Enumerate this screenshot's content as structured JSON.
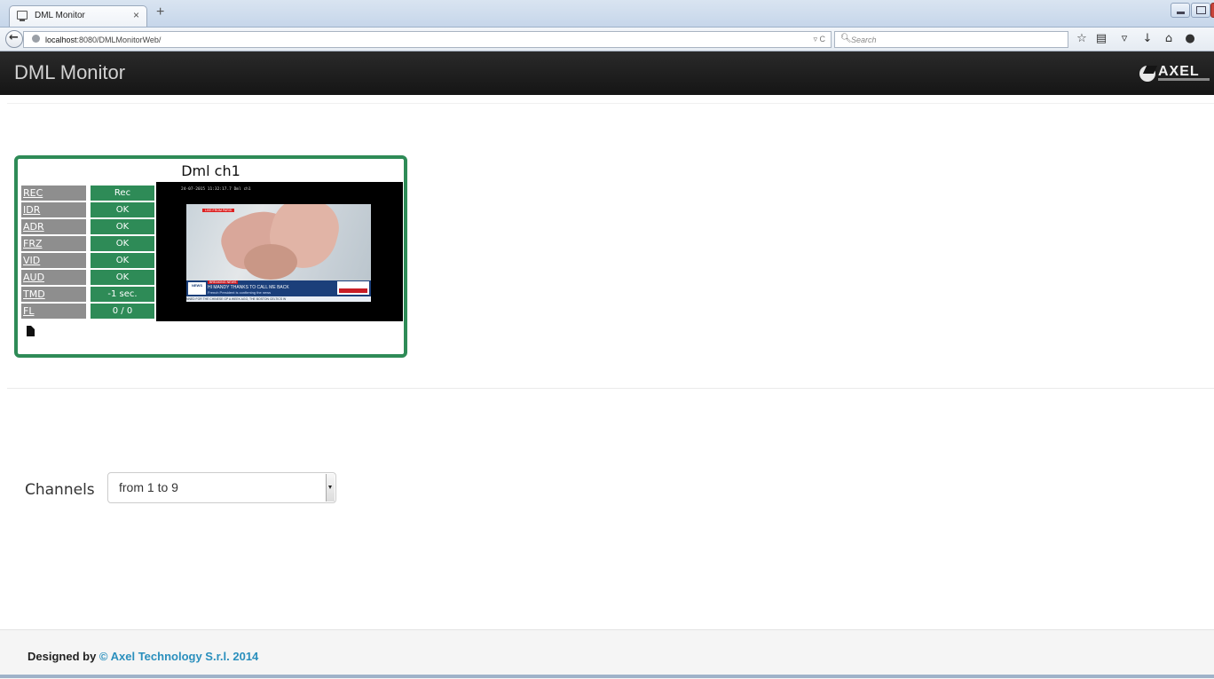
{
  "browser": {
    "tab_title": "DML Monitor",
    "tab_close": "×",
    "new_tab": "+",
    "url_host": "localhost",
    "url_rest": ":8080/DMLMonitorWeb/",
    "url_tools": "▿ C",
    "search_placeholder": "Search",
    "toolbar_icons": [
      "star-icon",
      "bookmarks-icon",
      "pocket-icon",
      "download-icon",
      "home-icon",
      "chat-icon"
    ]
  },
  "app": {
    "title": "DML Monitor",
    "logo_text": "AXEL"
  },
  "channel": {
    "name": "Dml ch1",
    "status": [
      {
        "label": "REC",
        "value": "Rec"
      },
      {
        "label": "IDR",
        "value": "OK"
      },
      {
        "label": "ADR",
        "value": "OK"
      },
      {
        "label": "FRZ",
        "value": "OK"
      },
      {
        "label": "VID",
        "value": "OK"
      },
      {
        "label": "AUD",
        "value": "OK"
      },
      {
        "label": "TMD",
        "value": "-1 sec."
      },
      {
        "label": "FL",
        "value": "0 / 0"
      }
    ],
    "preview": {
      "timestamp": "24-07-2015  11:32:17.7   Dml ch1",
      "live_tag": "LIVE FROM PARIS",
      "breaking": "BREAKING NEWS",
      "headline": "HI MANDY THANKS TO CALL ME BACK",
      "subline": "French President is confirming the news",
      "news_logo": "NEWS",
      "crawl": "NNED FOR THE CHINESE GP      A WEEK AGO, THE BOSTON CELTICS W"
    },
    "accent_color": "#2e8b57"
  },
  "channels_selector": {
    "label": "Channels",
    "selected": "from 1 to 9"
  },
  "footer": {
    "prefix": "Designed by ",
    "link": "© Axel Technology S.r.l. 2014"
  }
}
